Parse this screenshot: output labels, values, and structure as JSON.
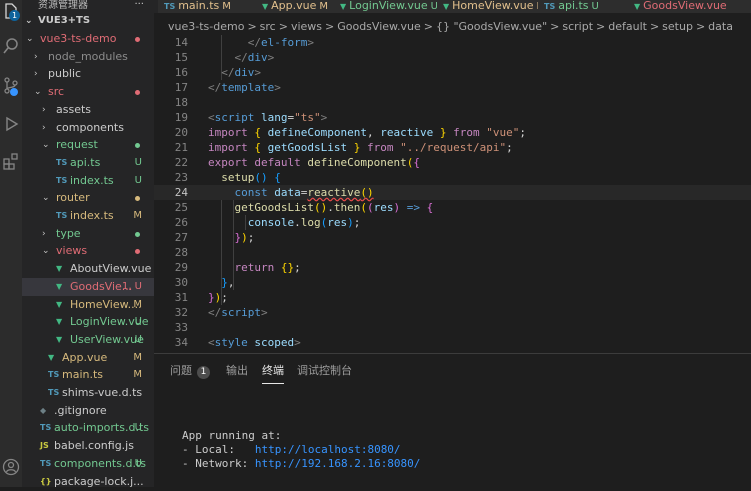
{
  "activity_bar": {
    "explorer_badge": "1"
  },
  "sidebar": {
    "header": "资源管理器",
    "more": "···",
    "section_title": "VUE3+TS",
    "tree": [
      {
        "label": "vue3-ts-demo",
        "type": "folder",
        "open": true,
        "status": "",
        "color": "red"
      },
      {
        "label": "node_modules",
        "type": "folder",
        "open": false,
        "status": "",
        "color": "dim"
      },
      {
        "label": "public",
        "type": "folder",
        "open": false,
        "status": "",
        "color": "gray"
      },
      {
        "label": "src",
        "type": "folder",
        "open": true,
        "status": "",
        "color": "red"
      },
      {
        "label": "assets",
        "type": "folder",
        "open": false,
        "status": "",
        "color": "gray"
      },
      {
        "label": "components",
        "type": "folder",
        "open": false,
        "status": "",
        "color": "gray"
      },
      {
        "label": "request",
        "type": "folder",
        "open": true,
        "status": "",
        "color": "green"
      },
      {
        "label": "api.ts",
        "type": "ts",
        "status": "U",
        "color": "green"
      },
      {
        "label": "index.ts",
        "type": "ts",
        "status": "U",
        "color": "green"
      },
      {
        "label": "router",
        "type": "folder",
        "open": true,
        "status": "",
        "color": "yellow"
      },
      {
        "label": "index.ts",
        "type": "ts",
        "status": "M",
        "color": "yellow"
      },
      {
        "label": "type",
        "type": "folder",
        "open": false,
        "status": "",
        "color": "green"
      },
      {
        "label": "views",
        "type": "folder",
        "open": true,
        "status": "",
        "color": "red"
      },
      {
        "label": "AboutView.vue",
        "type": "vue",
        "status": "",
        "color": "gray"
      },
      {
        "label": "GoodsVie...",
        "type": "vue",
        "status": "1, U",
        "color": "red",
        "selected": true
      },
      {
        "label": "HomeView....",
        "type": "vue",
        "status": "M",
        "color": "yellow"
      },
      {
        "label": "LoginView.vue",
        "type": "vue",
        "status": "U",
        "color": "green"
      },
      {
        "label": "UserView.vue",
        "type": "vue",
        "status": "U",
        "color": "green"
      },
      {
        "label": "App.vue",
        "type": "vue",
        "status": "M",
        "color": "yellow"
      },
      {
        "label": "main.ts",
        "type": "ts",
        "status": "M",
        "color": "yellow"
      },
      {
        "label": "shims-vue.d.ts",
        "type": "ts",
        "status": "",
        "color": "gray"
      },
      {
        "label": ".gitignore",
        "type": "git",
        "status": "",
        "color": "gray"
      },
      {
        "label": "auto-imports.d.ts",
        "type": "ts",
        "status": "U",
        "color": "green"
      },
      {
        "label": "babel.config.js",
        "type": "js",
        "status": "",
        "color": "gray"
      },
      {
        "label": "components.d.ts",
        "type": "ts",
        "status": "U",
        "color": "green"
      },
      {
        "label": "package-lock.j...",
        "type": "json",
        "status": "",
        "color": "gray"
      }
    ]
  },
  "tabs": [
    {
      "icon": "TS",
      "label": "main.ts",
      "status": "M"
    },
    {
      "icon": "V",
      "label": "App.vue",
      "status": "M"
    },
    {
      "icon": "V",
      "label": "LoginView.vue",
      "status": "U"
    },
    {
      "icon": "V",
      "label": "HomeView.vue",
      "status": "M"
    },
    {
      "icon": "TS",
      "label": "api.ts",
      "status": "U"
    },
    {
      "icon": "V",
      "label": "GoodsView.vue",
      "status": ""
    }
  ],
  "breadcrumb": [
    "vue3-ts-demo",
    ">",
    "src",
    ">",
    "views",
    ">",
    "GoodsView.vue",
    ">",
    "{} \"GoodsView.vue\"",
    ">",
    "script",
    ">",
    "default",
    ">",
    "setup",
    ">",
    "data"
  ],
  "editor": {
    "active_line": 24,
    "line_numbers": [
      "14",
      "15",
      "16",
      "17",
      "18",
      "19",
      "20",
      "21",
      "22",
      "23",
      "24",
      "25",
      "26",
      "27",
      "28",
      "29",
      "30",
      "31",
      "32",
      "33",
      "34"
    ]
  },
  "panel": {
    "tabs": [
      "问题",
      "输出",
      "终端",
      "调试控制台"
    ],
    "problems_count": "1",
    "active_tab": "终端",
    "terminal": {
      "line1": "App running at:",
      "local_label": "- Local:   ",
      "local_url": "http://localhost:8080/",
      "network_label": "- Network: ",
      "network_url": "http://192.168.2.16:8080/"
    }
  }
}
